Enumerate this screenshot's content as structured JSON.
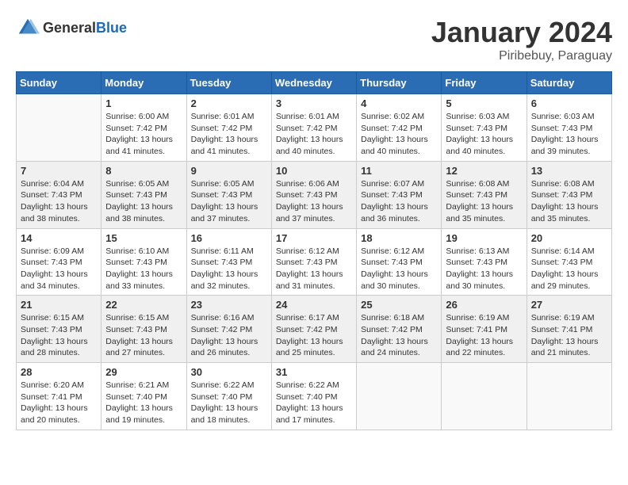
{
  "header": {
    "logo_general": "General",
    "logo_blue": "Blue",
    "month_year": "January 2024",
    "location": "Piribebuy, Paraguay"
  },
  "days_of_week": [
    "Sunday",
    "Monday",
    "Tuesday",
    "Wednesday",
    "Thursday",
    "Friday",
    "Saturday"
  ],
  "weeks": [
    [
      {
        "num": "",
        "info": ""
      },
      {
        "num": "1",
        "info": "Sunrise: 6:00 AM\nSunset: 7:42 PM\nDaylight: 13 hours\nand 41 minutes."
      },
      {
        "num": "2",
        "info": "Sunrise: 6:01 AM\nSunset: 7:42 PM\nDaylight: 13 hours\nand 41 minutes."
      },
      {
        "num": "3",
        "info": "Sunrise: 6:01 AM\nSunset: 7:42 PM\nDaylight: 13 hours\nand 40 minutes."
      },
      {
        "num": "4",
        "info": "Sunrise: 6:02 AM\nSunset: 7:42 PM\nDaylight: 13 hours\nand 40 minutes."
      },
      {
        "num": "5",
        "info": "Sunrise: 6:03 AM\nSunset: 7:43 PM\nDaylight: 13 hours\nand 40 minutes."
      },
      {
        "num": "6",
        "info": "Sunrise: 6:03 AM\nSunset: 7:43 PM\nDaylight: 13 hours\nand 39 minutes."
      }
    ],
    [
      {
        "num": "7",
        "info": "Sunrise: 6:04 AM\nSunset: 7:43 PM\nDaylight: 13 hours\nand 38 minutes."
      },
      {
        "num": "8",
        "info": "Sunrise: 6:05 AM\nSunset: 7:43 PM\nDaylight: 13 hours\nand 38 minutes."
      },
      {
        "num": "9",
        "info": "Sunrise: 6:05 AM\nSunset: 7:43 PM\nDaylight: 13 hours\nand 37 minutes."
      },
      {
        "num": "10",
        "info": "Sunrise: 6:06 AM\nSunset: 7:43 PM\nDaylight: 13 hours\nand 37 minutes."
      },
      {
        "num": "11",
        "info": "Sunrise: 6:07 AM\nSunset: 7:43 PM\nDaylight: 13 hours\nand 36 minutes."
      },
      {
        "num": "12",
        "info": "Sunrise: 6:08 AM\nSunset: 7:43 PM\nDaylight: 13 hours\nand 35 minutes."
      },
      {
        "num": "13",
        "info": "Sunrise: 6:08 AM\nSunset: 7:43 PM\nDaylight: 13 hours\nand 35 minutes."
      }
    ],
    [
      {
        "num": "14",
        "info": "Sunrise: 6:09 AM\nSunset: 7:43 PM\nDaylight: 13 hours\nand 34 minutes."
      },
      {
        "num": "15",
        "info": "Sunrise: 6:10 AM\nSunset: 7:43 PM\nDaylight: 13 hours\nand 33 minutes."
      },
      {
        "num": "16",
        "info": "Sunrise: 6:11 AM\nSunset: 7:43 PM\nDaylight: 13 hours\nand 32 minutes."
      },
      {
        "num": "17",
        "info": "Sunrise: 6:12 AM\nSunset: 7:43 PM\nDaylight: 13 hours\nand 31 minutes."
      },
      {
        "num": "18",
        "info": "Sunrise: 6:12 AM\nSunset: 7:43 PM\nDaylight: 13 hours\nand 30 minutes."
      },
      {
        "num": "19",
        "info": "Sunrise: 6:13 AM\nSunset: 7:43 PM\nDaylight: 13 hours\nand 30 minutes."
      },
      {
        "num": "20",
        "info": "Sunrise: 6:14 AM\nSunset: 7:43 PM\nDaylight: 13 hours\nand 29 minutes."
      }
    ],
    [
      {
        "num": "21",
        "info": "Sunrise: 6:15 AM\nSunset: 7:43 PM\nDaylight: 13 hours\nand 28 minutes."
      },
      {
        "num": "22",
        "info": "Sunrise: 6:15 AM\nSunset: 7:43 PM\nDaylight: 13 hours\nand 27 minutes."
      },
      {
        "num": "23",
        "info": "Sunrise: 6:16 AM\nSunset: 7:42 PM\nDaylight: 13 hours\nand 26 minutes."
      },
      {
        "num": "24",
        "info": "Sunrise: 6:17 AM\nSunset: 7:42 PM\nDaylight: 13 hours\nand 25 minutes."
      },
      {
        "num": "25",
        "info": "Sunrise: 6:18 AM\nSunset: 7:42 PM\nDaylight: 13 hours\nand 24 minutes."
      },
      {
        "num": "26",
        "info": "Sunrise: 6:19 AM\nSunset: 7:41 PM\nDaylight: 13 hours\nand 22 minutes."
      },
      {
        "num": "27",
        "info": "Sunrise: 6:19 AM\nSunset: 7:41 PM\nDaylight: 13 hours\nand 21 minutes."
      }
    ],
    [
      {
        "num": "28",
        "info": "Sunrise: 6:20 AM\nSunset: 7:41 PM\nDaylight: 13 hours\nand 20 minutes."
      },
      {
        "num": "29",
        "info": "Sunrise: 6:21 AM\nSunset: 7:40 PM\nDaylight: 13 hours\nand 19 minutes."
      },
      {
        "num": "30",
        "info": "Sunrise: 6:22 AM\nSunset: 7:40 PM\nDaylight: 13 hours\nand 18 minutes."
      },
      {
        "num": "31",
        "info": "Sunrise: 6:22 AM\nSunset: 7:40 PM\nDaylight: 13 hours\nand 17 minutes."
      },
      {
        "num": "",
        "info": ""
      },
      {
        "num": "",
        "info": ""
      },
      {
        "num": "",
        "info": ""
      }
    ]
  ]
}
